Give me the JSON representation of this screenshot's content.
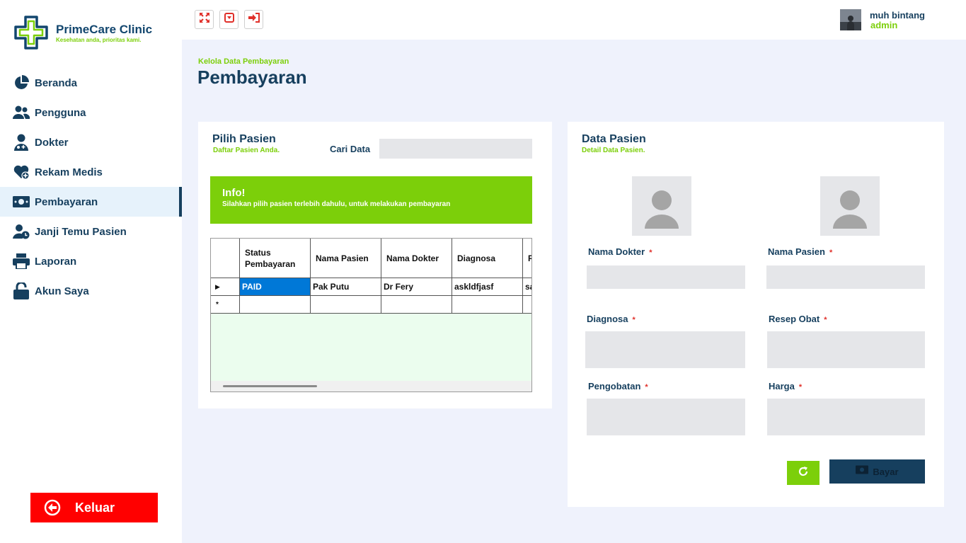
{
  "brand": {
    "name": "PrimeCare Clinic",
    "tagline": "Kesehatan anda, prioritas kami.",
    "primary_color": "#163f5e",
    "accent_color": "#7ccf0a"
  },
  "sidebar": {
    "items": [
      {
        "label": "Beranda",
        "icon": "pie-chart-icon",
        "active": false
      },
      {
        "label": "Pengguna",
        "icon": "users-icon",
        "active": false
      },
      {
        "label": "Dokter",
        "icon": "doctor-icon",
        "active": false
      },
      {
        "label": "Rekam Medis",
        "icon": "heart-hand-icon",
        "active": false
      },
      {
        "label": "Pembayaran",
        "icon": "money-icon",
        "active": true
      },
      {
        "label": "Janji Temu Pasien",
        "icon": "user-clock-icon",
        "active": false
      },
      {
        "label": "Laporan",
        "icon": "printer-icon",
        "active": false
      },
      {
        "label": "Akun Saya",
        "icon": "unlock-icon",
        "active": false
      }
    ],
    "logout_label": "Keluar",
    "logout_color": "#ff0000"
  },
  "topbar": {
    "buttons": [
      {
        "icon": "fullscreen-icon"
      },
      {
        "icon": "minimize-icon"
      },
      {
        "icon": "sign-out-icon"
      }
    ],
    "user": {
      "name": "muh bintang",
      "role": "admin"
    }
  },
  "page": {
    "breadcrumb": "Kelola Data Pembayaran",
    "title": "Pembayaran"
  },
  "patient_picker": {
    "title": "Pilih Pasien",
    "subtitle": "Daftar Pasien Anda.",
    "search_label": "Cari Data",
    "search_value": "",
    "info_title": "Info!",
    "info_text": "Silahkan pilih pasien terlebih dahulu, untuk melakukan pembayaran",
    "table": {
      "columns": [
        "Status Pembayaran",
        "Nama Pasien",
        "Nama Dokter",
        "Diagnosa",
        "R"
      ],
      "rows": [
        {
          "marker": "▶",
          "cells": [
            "PAID",
            "Pak Putu",
            "Dr Fery",
            "askldfjasf",
            "sa"
          ]
        },
        {
          "marker": "*",
          "cells": [
            "",
            "",
            "",
            "",
            ""
          ]
        }
      ]
    }
  },
  "patient_detail": {
    "title": "Data Pasien",
    "subtitle": "Detail Data Pasien.",
    "fields": {
      "doctor_name": {
        "label": "Nama Dokter",
        "value": ""
      },
      "patient_name": {
        "label": "Nama Pasien",
        "value": ""
      },
      "diagnosis": {
        "label": "Diagnosa",
        "value": ""
      },
      "prescription": {
        "label": "Resep Obat",
        "value": ""
      },
      "treatment": {
        "label": "Pengobatan",
        "value": ""
      },
      "price": {
        "label": "Harga",
        "value": ""
      }
    },
    "required_mark": "*",
    "pay_label": "Bayar"
  }
}
